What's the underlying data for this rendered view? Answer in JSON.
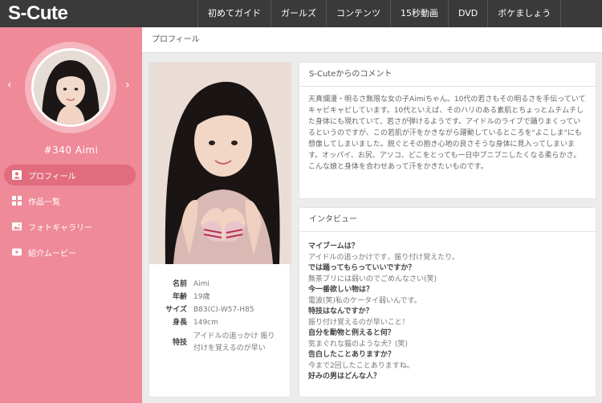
{
  "site": {
    "logo": "S-Cute"
  },
  "nav": [
    "初めてガイド",
    "ガールズ",
    "コンテンツ",
    "15秒動画",
    "DVD",
    "ボケましょう"
  ],
  "sidebar": {
    "prev_arrow": "‹",
    "next_arrow": "›",
    "girl_name": "#340 Aimi",
    "menu": [
      {
        "label": "プロフィール",
        "icon": "person-icon",
        "active": true
      },
      {
        "label": "作品一覧",
        "icon": "grid-icon",
        "active": false
      },
      {
        "label": "フォトギャラリー",
        "icon": "image-icon",
        "active": false
      },
      {
        "label": "紹介ムービー",
        "icon": "play-icon",
        "active": false
      }
    ]
  },
  "main": {
    "header": "プロフィール"
  },
  "profile": [
    {
      "key": "名前",
      "value": "Aimi"
    },
    {
      "key": "年齢",
      "value": "19歳"
    },
    {
      "key": "サイズ",
      "value": "B83(C)-W57-H85"
    },
    {
      "key": "身長",
      "value": "149cm"
    },
    {
      "key": "特技",
      "value": "アイドルの追っかけ 振り付けを覚えるのが早い"
    }
  ],
  "comment": {
    "title": "S-Cuteからのコメント",
    "text": "天真爛漫・明るさ無限な女の子Aimiちゃん。10代の若さもその明るさを手伝っていてキャピキャピしています。10代といえば、そのハリのある素肌とちょっとムチムチした身体にも現れていて、若さが弾けるようです。アイドルのライブで踊りまくっているというのですが、この若肌が汗をかきながら躍動しているところを\"よこしま\"にも想像してしまいました。脱ぐとその抱き心地の良さそうな身体に見入ってしまいます。オッパイ、お尻、アソコ、どこをとっても一日中プニプニしたくなる柔らかさ。こんな娘と身体を合わせあって汗をかきたいものです。"
  },
  "interview": {
    "title": "インタビュー",
    "qa": [
      {
        "q": "マイブームは？",
        "a": "アイドルの追っかけです，振り付け覚えたり。"
      },
      {
        "q": "では踊ってもらっていいですか？",
        "a": "無茶ブリには弱いのでごめんなさい(笑)"
      },
      {
        "q": "今一番欲しい物は？",
        "a": "電波(笑)私のケータイ弱いんです。"
      },
      {
        "q": "特技はなんですか？",
        "a": "振り付け覚えるのが早いこと！"
      },
      {
        "q": "自分を動物と例えると何？",
        "a": "気まぐれな猫のような犬？(笑)"
      },
      {
        "q": "告白したことありますか？",
        "a": "今まで2回したことありますね。"
      },
      {
        "q": "好みの男はどんな人？",
        "a": ""
      }
    ]
  },
  "colors": {
    "sidebar": "#ef8a98",
    "topbar": "#3a3a3a",
    "menu_active": "#e06c7d"
  }
}
